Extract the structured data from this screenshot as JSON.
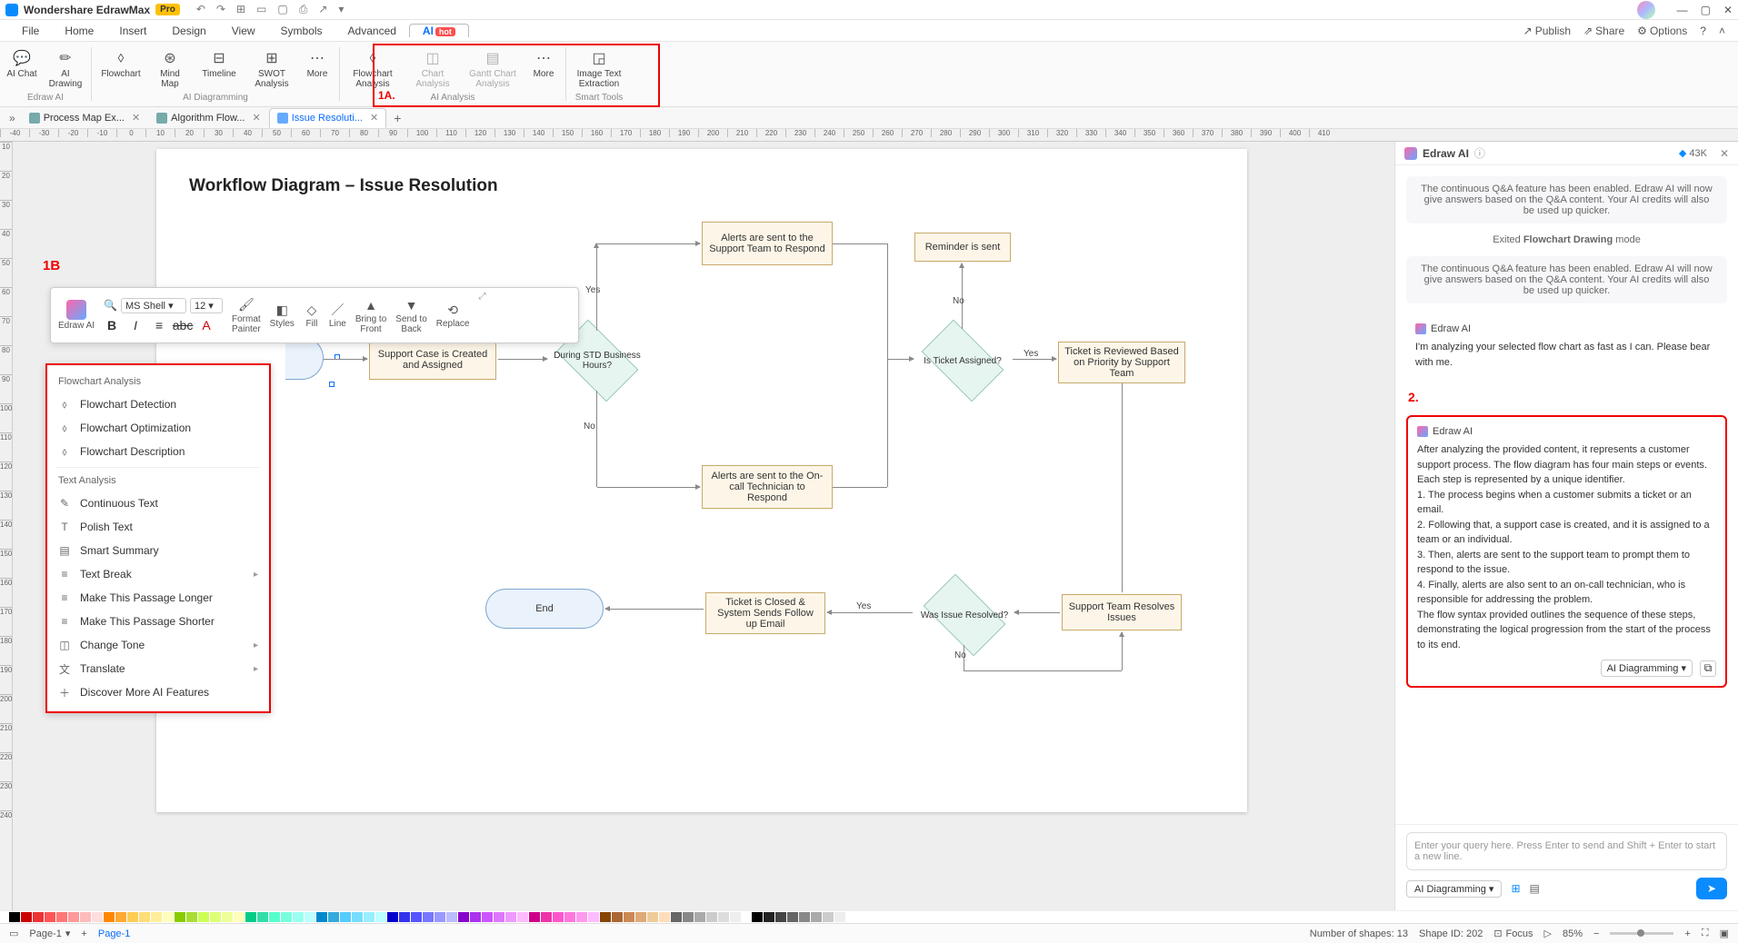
{
  "app": {
    "name": "Wondershare EdrawMax",
    "badge": "Pro"
  },
  "menu": {
    "items": [
      "File",
      "Home",
      "Insert",
      "Design",
      "View",
      "Symbols",
      "Advanced",
      "AI"
    ],
    "hot": "hot",
    "right": {
      "publish": "Publish",
      "share": "Share",
      "options": "Options"
    }
  },
  "ribbon": {
    "edraw_ai": {
      "ai_chat": "AI\nChat",
      "ai_drawing": "AI\nDrawing",
      "label": "Edraw AI"
    },
    "diagramming": {
      "flowchart": "Flowchart",
      "mindmap": "Mind\nMap",
      "timeline": "Timeline",
      "swot": "SWOT\nAnalysis",
      "more": "More",
      "label": "AI Diagramming"
    },
    "analysis": {
      "flowchart": "Flowchart\nAnalysis",
      "chart": "Chart\nAnalysis",
      "gantt": "Gantt Chart\nAnalysis",
      "more": "More",
      "label": "AI Analysis"
    },
    "smart": {
      "imgtext": "Image Text\nExtraction",
      "label": "Smart Tools"
    }
  },
  "tabs": [
    {
      "title": "Process Map Ex...",
      "active": false
    },
    {
      "title": "Algorithm Flow...",
      "active": false
    },
    {
      "title": "Issue Resoluti...",
      "active": true
    }
  ],
  "annotations": {
    "a1": "1A.",
    "b1": "1B",
    "c2": "2."
  },
  "float_tb": {
    "edraw": "Edraw AI",
    "font": "MS Shell",
    "size": "12",
    "format_painter": "Format\nPainter",
    "styles": "Styles",
    "fill": "Fill",
    "line": "Line",
    "bring": "Bring to\nFront",
    "send": "Send to\nBack",
    "replace": "Replace"
  },
  "ctx": {
    "sec1": "Flowchart Analysis",
    "items1": [
      "Flowchart Detection",
      "Flowchart Optimization",
      "Flowchart Description"
    ],
    "sec2": "Text Analysis",
    "items2": [
      "Continuous Text",
      "Polish Text",
      "Smart Summary",
      "Text Break",
      "Make This Passage Longer",
      "Make This Passage Shorter",
      "Change Tone",
      "Translate",
      "Discover More AI Features"
    ],
    "submenu_idx": [
      3,
      6,
      7
    ]
  },
  "diagram": {
    "title": "Workflow Diagram – Issue Resolution",
    "nodes": {
      "case": "Support Case is\nCreated and Assigned",
      "hours": "During STD\nBusiness\nHours?",
      "alerts_team": "Alerts are sent to the\nSupport Team to\nRespond",
      "alerts_oncall": "Alerts are sent to the\nOn-call Technician to\nRespond",
      "assigned": "Is Ticket\nAssigned?",
      "reminder": "Reminder is sent",
      "review": "Ticket is Reviewed\nBased  on Priority by\nSupport Team",
      "resolves": "Support Team\nResolves Issues",
      "was_resolved": "Was Issue\nResolved?",
      "closed": "Ticket is Closed &\nSystem Sends Follow\nup Email",
      "end": "End"
    },
    "labels": {
      "yes": "Yes",
      "no": "No"
    }
  },
  "ai_panel": {
    "title": "Edraw AI",
    "credits": "43K",
    "msg1": "The continuous Q&A feature has been enabled. Edraw AI will now give answers based on the Q&A content. Your AI credits will also be used up quicker.",
    "status": "Exited Flowchart Drawing mode",
    "msg1b": "The continuous Q&A feature has been enabled. Edraw AI will now give answers based on the Q&A content. Your AI credits will also be used up quicker.",
    "analyzing": "I'm analyzing your selected flow chart as fast as I can. Please bear with me.",
    "result": "After analyzing the provided content, it represents a customer support process. The flow diagram has four main steps or events. Each step is represented by a unique identifier.\n1. The process begins when a customer submits a ticket or an email.\n2. Following that, a support case is created, and it is assigned to a team or an individual.\n3. Then, alerts are sent to the support team to prompt them to respond to the issue.\n4. Finally, alerts are also sent to an on-call technician, who is responsible for addressing the problem.\nThe flow syntax provided outlines the sequence of these steps, demonstrating the logical progression from the start of the process to its end.",
    "dd": "AI Diagramming",
    "placeholder": "Enter your query here. Press Enter to send and Shift + Enter to start a new line.",
    "dd2": "AI Diagramming"
  },
  "status": {
    "page": "Page-1",
    "page2": "Page-1",
    "shapes": "Number of shapes: 13",
    "shape_id": "Shape ID: 202",
    "focus": "Focus",
    "zoom": "85%"
  },
  "ruler_h": [
    "-40",
    "-30",
    "-20",
    "-10",
    "0",
    "10",
    "20",
    "30",
    "40",
    "50",
    "60",
    "70",
    "80",
    "90",
    "100",
    "110",
    "120",
    "130",
    "140",
    "150",
    "160",
    "170",
    "180",
    "190",
    "200",
    "210",
    "220",
    "230",
    "240",
    "250",
    "260",
    "270",
    "280",
    "290",
    "300",
    "310",
    "320",
    "330",
    "340",
    "350",
    "360",
    "370",
    "380",
    "390",
    "400",
    "410"
  ],
  "ruler_v": [
    "10",
    "20",
    "30",
    "40",
    "50",
    "60",
    "70",
    "80",
    "90",
    "100",
    "110",
    "120",
    "130",
    "140",
    "150",
    "160",
    "170",
    "180",
    "190",
    "200",
    "210",
    "220",
    "230",
    "240"
  ],
  "palette": [
    "#000",
    "#c00",
    "#e33",
    "#f55",
    "#f77",
    "#f99",
    "#fbb",
    "#fdd",
    "#f80",
    "#fa3",
    "#fc5",
    "#fd7",
    "#fe9",
    "#ffb",
    "#8c0",
    "#ad3",
    "#cf5",
    "#df7",
    "#ef9",
    "#ffb",
    "#0c8",
    "#3da",
    "#5fc",
    "#7fd",
    "#9fe",
    "#bff",
    "#08c",
    "#3ad",
    "#5cf",
    "#7df",
    "#9ef",
    "#bff",
    "#00c",
    "#33e",
    "#55f",
    "#77f",
    "#99f",
    "#bbf",
    "#80c",
    "#a3e",
    "#c5f",
    "#d7f",
    "#e9f",
    "#fbf",
    "#c08",
    "#e3a",
    "#f5c",
    "#f7d",
    "#f9e",
    "#fbf",
    "#840",
    "#a63",
    "#c85",
    "#da7",
    "#ec9",
    "#fdb",
    "#666",
    "#888",
    "#aaa",
    "#ccc",
    "#ddd",
    "#eee"
  ],
  "palette2": [
    "#000",
    "#222",
    "#444",
    "#666",
    "#888",
    "#aaa",
    "#ccc",
    "#eee",
    "#fff"
  ]
}
